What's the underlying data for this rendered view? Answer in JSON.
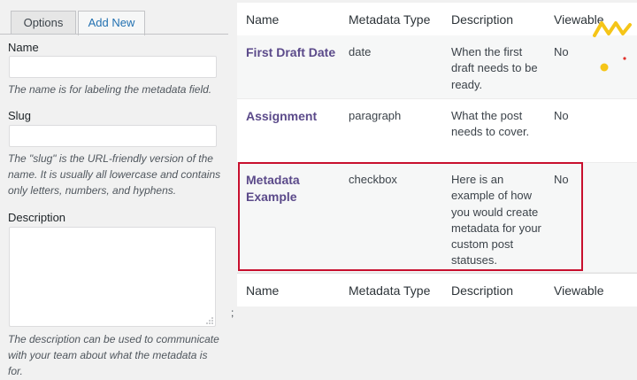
{
  "tabs": {
    "options_label": "Options",
    "add_new_label": "Add New"
  },
  "form": {
    "name_label": "Name",
    "name_help": "The name is for labeling the metadata field.",
    "slug_label": "Slug",
    "slug_help": "The \"slug\" is the URL-friendly version of the name. It is usually all lowercase and contains only letters, numbers, and hyphens.",
    "description_label": "Description",
    "description_help": "The description can be used to communicate with your team about what the metadata is for."
  },
  "table": {
    "headers": [
      "Name",
      "Metadata Type",
      "Description",
      "Viewable"
    ],
    "rows": [
      {
        "name": "First Draft Date",
        "type": "date",
        "description": "When the first draft needs to be ready.",
        "viewable": "No"
      },
      {
        "name": "Assignment",
        "type": "paragraph",
        "description": "What the post needs to cover.",
        "viewable": "No"
      },
      {
        "name": "Metadata Example",
        "type": "checkbox",
        "description": "Here is an example of how you would create metadata for your custom post statuses.",
        "viewable": "No"
      }
    ]
  },
  "stray_text": ";",
  "colors": {
    "highlight_border": "#c8102e",
    "link_name": "#5b4a8a",
    "deco_yellow": "#f5c518",
    "deco_red": "#e0302a"
  },
  "icons": [
    "resize-grip-icon",
    "decorative-zigzag-icon"
  ]
}
